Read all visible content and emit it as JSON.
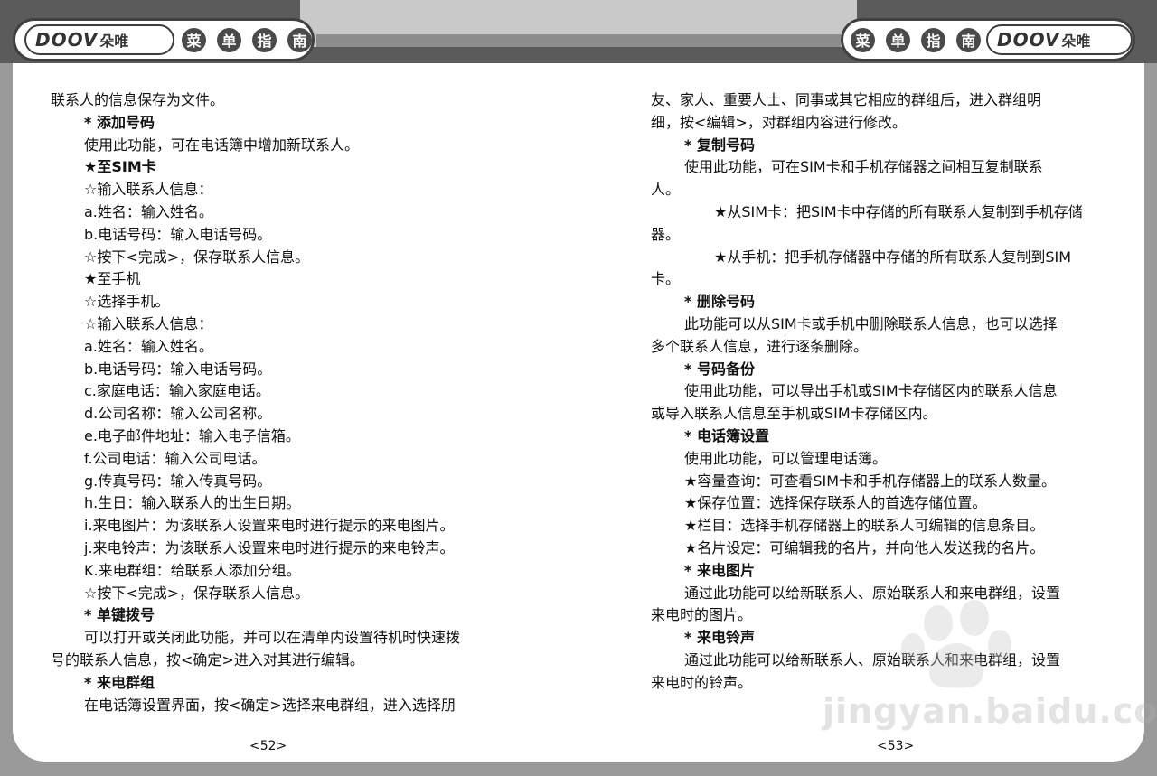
{
  "header": {
    "logo_brand": "DOOV",
    "logo_cn": "朵唯",
    "menu_title": [
      "菜",
      "单",
      "指",
      "南"
    ]
  },
  "left_page": {
    "lines": [
      {
        "text": "联系人的信息保存为文件。",
        "indent": 0,
        "bold": false
      },
      {
        "text": "* 添加号码",
        "indent": 1,
        "bold": true
      },
      {
        "text": "使用此功能，可在电话簿中增加新联系人。",
        "indent": 1,
        "bold": false
      },
      {
        "text": "★至SIM卡",
        "indent": 1,
        "bold": true
      },
      {
        "text": "☆输入联系人信息：",
        "indent": 1,
        "bold": false
      },
      {
        "text": "a.姓名：输入姓名。",
        "indent": 1,
        "bold": false
      },
      {
        "text": "b.电话号码：输入电话号码。",
        "indent": 1,
        "bold": false
      },
      {
        "text": "☆按下<完成>，保存联系人信息。",
        "indent": 1,
        "bold": false
      },
      {
        "text": "★至手机",
        "indent": 1,
        "bold": false
      },
      {
        "text": "☆选择手机。",
        "indent": 1,
        "bold": false
      },
      {
        "text": "☆输入联系人信息：",
        "indent": 1,
        "bold": false
      },
      {
        "text": "a.姓名：输入姓名。",
        "indent": 1,
        "bold": false
      },
      {
        "text": "b.电话号码：输入电话号码。",
        "indent": 1,
        "bold": false
      },
      {
        "text": "c.家庭电话：输入家庭电话。",
        "indent": 1,
        "bold": false
      },
      {
        "text": "d.公司名称：输入公司名称。",
        "indent": 1,
        "bold": false
      },
      {
        "text": "e.电子邮件地址：输入电子信箱。",
        "indent": 1,
        "bold": false
      },
      {
        "text": "f.公司电话：输入公司电话。",
        "indent": 1,
        "bold": false
      },
      {
        "text": "g.传真号码：输入传真号码。",
        "indent": 1,
        "bold": false
      },
      {
        "text": "h.生日：输入联系人的出生日期。",
        "indent": 1,
        "bold": false
      },
      {
        "text": "i.来电图片：为该联系人设置来电时进行提示的来电图片。",
        "indent": 1,
        "bold": false
      },
      {
        "text": "j.来电铃声：为该联系人设置来电时进行提示的来电铃声。",
        "indent": 1,
        "bold": false
      },
      {
        "text": "K.来电群组：给联系人添加分组。",
        "indent": 1,
        "bold": false
      },
      {
        "text": "☆按下<完成>，保存联系人信息。",
        "indent": 1,
        "bold": false
      },
      {
        "text": "* 单键拨号",
        "indent": 1,
        "bold": true
      },
      {
        "text": "可以打开或关闭此功能，并可以在清单内设置待机时快速拨",
        "indent": 1,
        "bold": false
      },
      {
        "text": "号的联系人信息，按<确定>进入对其进行编辑。",
        "indent": 0,
        "bold": false
      },
      {
        "text": "* 来电群组",
        "indent": 1,
        "bold": true
      },
      {
        "text": "在电话簿设置界面，按<确定>选择来电群组，进入选择朋",
        "indent": 1,
        "bold": false
      }
    ],
    "page_number": "<52>"
  },
  "right_page": {
    "lines": [
      {
        "text": "友、家人、重要人士、同事或其它相应的群组后，进入群组明",
        "indent": 0,
        "bold": false
      },
      {
        "text": "细，按<编辑>，对群组内容进行修改。",
        "indent": 0,
        "bold": false
      },
      {
        "text": "* 复制号码",
        "indent": 1,
        "bold": true
      },
      {
        "text": "使用此功能，可在SIM卡和手机存储器之间相互复制联系",
        "indent": 1,
        "bold": false
      },
      {
        "text": "人。",
        "indent": 0,
        "bold": false
      },
      {
        "text": "★从SIM卡：把SIM卡中存储的所有联系人复制到手机存储",
        "indent": 2,
        "bold": false
      },
      {
        "text": "器。",
        "indent": 0,
        "bold": false
      },
      {
        "text": "★从手机：把手机存储器中存储的所有联系人复制到SIM",
        "indent": 2,
        "bold": false
      },
      {
        "text": "卡。",
        "indent": 0,
        "bold": false
      },
      {
        "text": "* 删除号码",
        "indent": 1,
        "bold": true
      },
      {
        "text": "此功能可以从SIM卡或手机中删除联系人信息，也可以选择",
        "indent": 1,
        "bold": false
      },
      {
        "text": "多个联系人信息，进行逐条删除。",
        "indent": 0,
        "bold": false
      },
      {
        "text": "* 号码备份",
        "indent": 1,
        "bold": true
      },
      {
        "text": "使用此功能，可以导出手机或SIM卡存储区内的联系人信息",
        "indent": 1,
        "bold": false
      },
      {
        "text": "或导入联系人信息至手机或SIM卡存储区内。",
        "indent": 0,
        "bold": false
      },
      {
        "text": "* 电话簿设置",
        "indent": 1,
        "bold": true
      },
      {
        "text": "使用此功能，可以管理电话簿。",
        "indent": 1,
        "bold": false
      },
      {
        "text": "★容量查询：可查看SIM卡和手机存储器上的联系人数量。",
        "indent": 1,
        "bold": false
      },
      {
        "text": "★保存位置：选择保存联系人的首选存储位置。",
        "indent": 1,
        "bold": false
      },
      {
        "text": "★栏目：选择手机存储器上的联系人可编辑的信息条目。",
        "indent": 1,
        "bold": false
      },
      {
        "text": "★名片设定：可编辑我的名片，并向他人发送我的名片。",
        "indent": 1,
        "bold": false
      },
      {
        "text": "* 来电图片",
        "indent": 1,
        "bold": true
      },
      {
        "text": "通过此功能可以给新联系人、原始联系人和来电群组，设置",
        "indent": 1,
        "bold": false
      },
      {
        "text": "来电时的图片。",
        "indent": 0,
        "bold": false
      },
      {
        "text": "* 来电铃声",
        "indent": 1,
        "bold": true
      },
      {
        "text": "通过此功能可以给新联系人、原始联系人和来电群组，设置",
        "indent": 1,
        "bold": false
      },
      {
        "text": "来电时的铃声。",
        "indent": 0,
        "bold": false
      }
    ],
    "page_number": "<53>"
  },
  "watermark": {
    "text": "jingyan.baidu.com"
  }
}
